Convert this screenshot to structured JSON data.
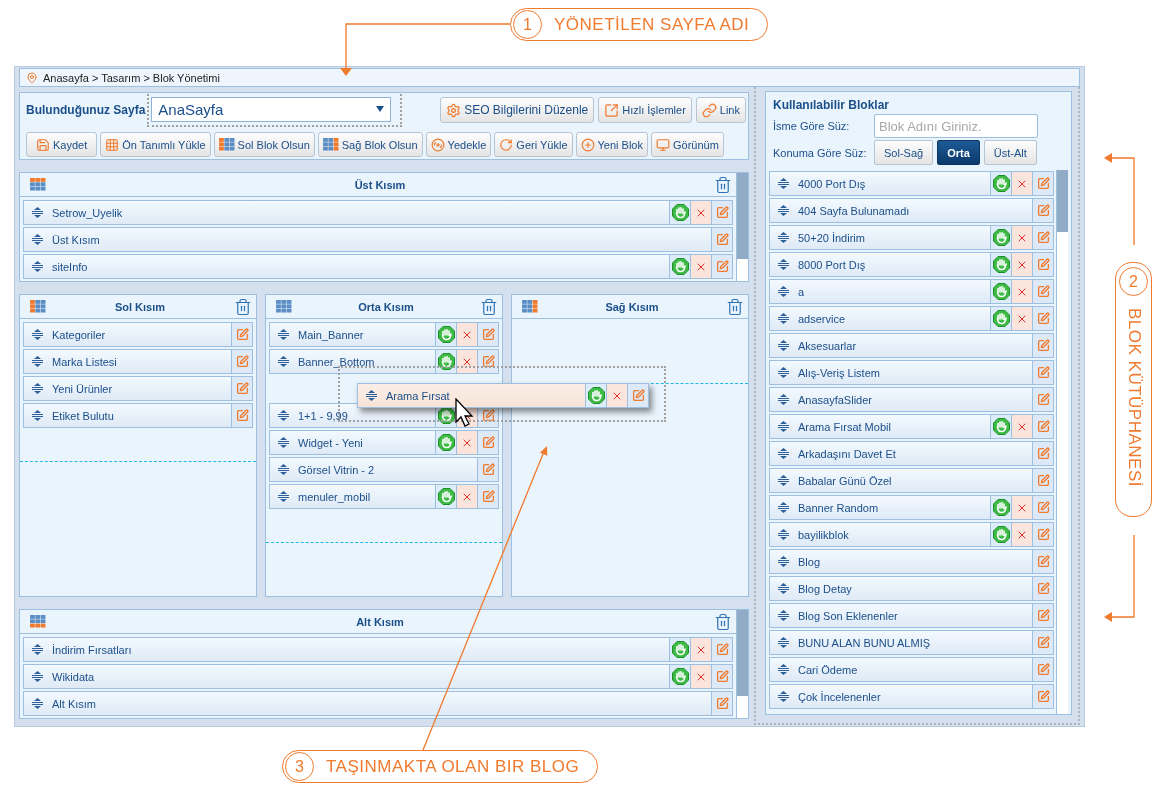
{
  "callouts": [
    {
      "number": "1",
      "text": "YÖNETİLEN SAYFA ADI"
    },
    {
      "number": "2",
      "text": "BLOK KÜTÜPHANESİ"
    },
    {
      "number": "3",
      "text": "TAŞINMAKTA OLAN BIR BLOG"
    }
  ],
  "breadcrumb": "Anasayfa > Tasarım > Blok Yönetimi",
  "page_select": {
    "label": "Bulunduğunuz Sayfa",
    "value": "AnaSayfa"
  },
  "top_buttons": [
    "SEO Bilgilerini Düzenle",
    "Hızlı İşlemler",
    "Link"
  ],
  "toolbar": [
    "Kaydet",
    "Ön Tanımlı Yükle",
    "Sol Blok Olsun",
    "Sağ Blok Olsun",
    "Yedekle",
    "Geri Yükle",
    "Yeni Blok",
    "Görünüm"
  ],
  "top_zone": {
    "title": "Üst Kısım",
    "kind": "top",
    "blocks": [
      {
        "name": "Setrow_Uyelik",
        "kind": "full"
      },
      {
        "name": "Üst Kısım",
        "kind": "edit"
      },
      {
        "name": "siteInfo",
        "kind": "full"
      }
    ]
  },
  "columns": [
    {
      "title": "Sol Kısım",
      "kind": "left",
      "blocks": [
        {
          "name": "Kategoriler",
          "kind": "edit",
          "dragging": false
        },
        {
          "name": "Marka Listesi",
          "kind": "edit",
          "dragging": false
        },
        {
          "name": "Yeni Ürünler",
          "kind": "edit",
          "dragging": false
        },
        {
          "name": "Etiket Bulutu",
          "kind": "edit",
          "dragging": false
        }
      ]
    },
    {
      "title": "Orta Kısım",
      "kind": "center",
      "blocks": [
        {
          "name": "Main_Banner",
          "kind": "full",
          "dragging": false
        },
        {
          "name": "Banner_Bottom",
          "kind": "full",
          "dragging": false
        },
        {
          "name": "Arama Fırsat",
          "kind": "full",
          "dragging": true
        },
        {
          "name": "1+1 - 9,99",
          "kind": "full",
          "dragging": false
        },
        {
          "name": "Widget - Yeni",
          "kind": "full",
          "dragging": false
        },
        {
          "name": "Görsel Vitrin - 2",
          "kind": "edit",
          "dragging": false
        },
        {
          "name": "menuler_mobil",
          "kind": "full",
          "dragging": false
        }
      ]
    },
    {
      "title": "Sağ Kısım",
      "kind": "right"
    }
  ],
  "bottom_zone": {
    "title": "Alt Kısım",
    "kind": "bottom",
    "blocks": [
      {
        "name": "İndirim Fırsatları",
        "kind": "full"
      },
      {
        "name": "Wikidata",
        "kind": "full"
      },
      {
        "name": "Alt Kısım",
        "kind": "edit"
      }
    ]
  },
  "library": {
    "title": "Kullanılabilir Bloklar",
    "name_filter_label": "İsme Göre Süz:",
    "name_filter": {
      "placeholder": "Blok Adını Giriniz."
    },
    "position_filter_label": "Konuma Göre Süz:",
    "filters": [
      {
        "label": "Sol-Sağ",
        "selected": false
      },
      {
        "label": "Orta",
        "selected": true
      },
      {
        "label": "Üst-Alt",
        "selected": false
      }
    ],
    "blocks": [
      {
        "name": "4000 Port Dış",
        "kind": "full"
      },
      {
        "name": "404 Sayfa Bulunamadı",
        "kind": "edit"
      },
      {
        "name": "50+20 İndirim",
        "kind": "full"
      },
      {
        "name": "8000 Port Dış",
        "kind": "full"
      },
      {
        "name": "a",
        "kind": "full"
      },
      {
        "name": "adservice",
        "kind": "full"
      },
      {
        "name": "Aksesuarlar",
        "kind": "edit"
      },
      {
        "name": "Alış-Veriş Listem",
        "kind": "edit"
      },
      {
        "name": "AnasayfaSlider",
        "kind": "edit"
      },
      {
        "name": "Arama Fırsat Mobil",
        "kind": "full"
      },
      {
        "name": "Arkadaşını Davet Et",
        "kind": "edit"
      },
      {
        "name": "Babalar Günü Özel",
        "kind": "edit"
      },
      {
        "name": "Banner Random",
        "kind": "full"
      },
      {
        "name": "bayilikblok",
        "kind": "full"
      },
      {
        "name": "Blog",
        "kind": "edit"
      },
      {
        "name": "Blog Detay",
        "kind": "edit"
      },
      {
        "name": "Blog Son Eklenenler",
        "kind": "edit"
      },
      {
        "name": "BUNU ALAN BUNU ALMIŞ",
        "kind": "edit"
      },
      {
        "name": "Cari Ödeme",
        "kind": "edit"
      },
      {
        "name": "Çok İncelenenler",
        "kind": "edit"
      }
    ]
  }
}
